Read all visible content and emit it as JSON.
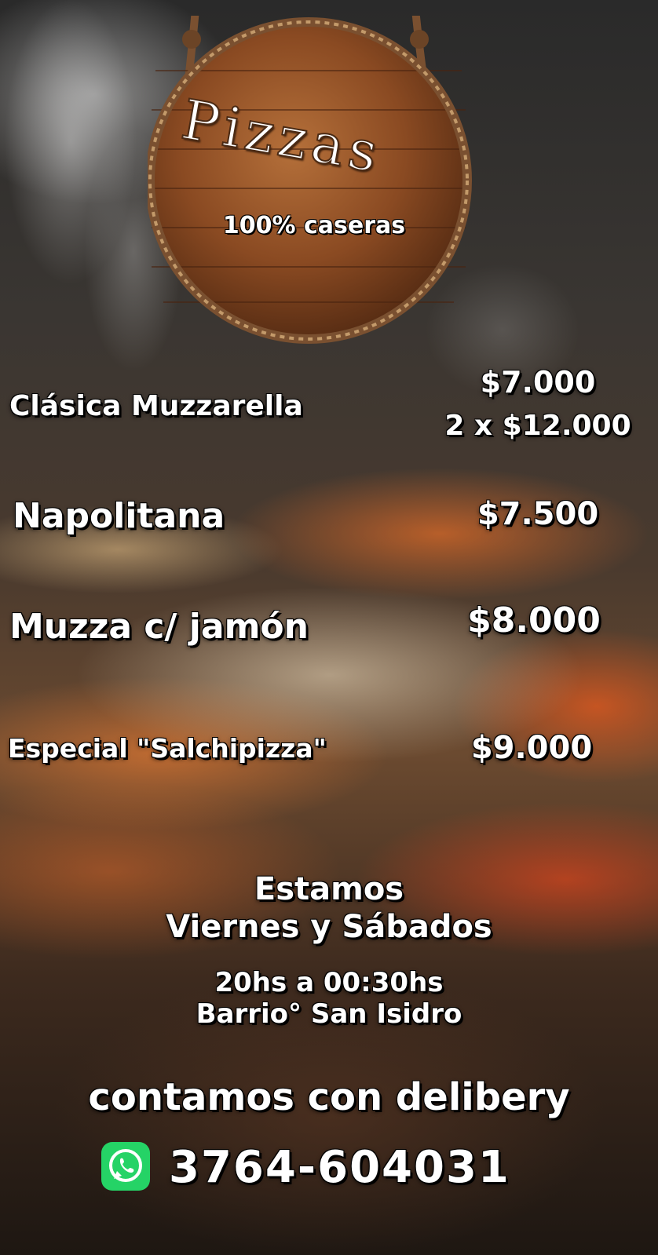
{
  "header": {
    "title": "Pizzas",
    "subtitle": "100% caseras"
  },
  "menu": [
    {
      "name": "Clásica Muzzarella",
      "price": "$7.000",
      "promo": "2 x $12.000"
    },
    {
      "name": "Napolitana",
      "price": "$7.500"
    },
    {
      "name": "Muzza c/ jamón",
      "price": "$8.000"
    },
    {
      "name": "Especial \"Salchipizza\"",
      "price": "$9.000"
    }
  ],
  "schedule": {
    "line1": "Estamos",
    "days": "Viernes y Sábados",
    "hours": "20hs a 00:30hs",
    "location": "Barrio° San Isidro"
  },
  "delivery": "contamos con delibery",
  "contact": {
    "icon": "whatsapp-icon",
    "phone": "3764-604031"
  },
  "colors": {
    "text": "#ffffff",
    "wood": "#8b4a22",
    "whatsapp": "#25d366"
  }
}
